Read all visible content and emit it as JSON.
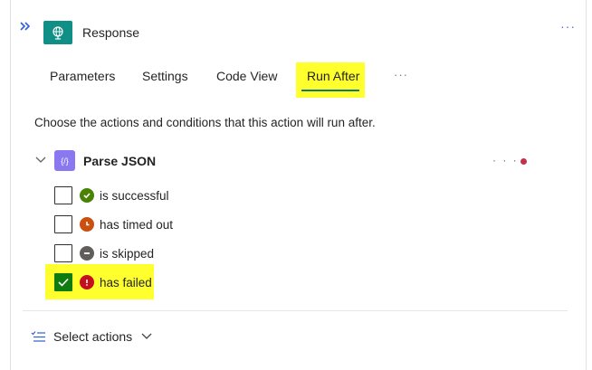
{
  "header": {
    "title": "Response",
    "more_label": "···",
    "collapse_label": "»"
  },
  "tabs": [
    {
      "label": "Parameters",
      "selected": false
    },
    {
      "label": "Settings",
      "selected": false
    },
    {
      "label": "Code View",
      "selected": false
    },
    {
      "label": "Run After",
      "selected": true
    }
  ],
  "tabs_more_label": "···",
  "description": "Choose the actions and conditions that this action will run after.",
  "action": {
    "title": "Parse JSON",
    "icon_text": "{/}",
    "more_label": "· · ·",
    "status_color": "#c4314b"
  },
  "options": [
    {
      "label": "is successful",
      "checked": false,
      "icon": "check-circle-icon",
      "color": "#498205"
    },
    {
      "label": "has timed out",
      "checked": false,
      "icon": "clock-icon",
      "color": "#ca5010"
    },
    {
      "label": "is skipped",
      "checked": false,
      "icon": "skip-icon",
      "color": "#605e5c"
    },
    {
      "label": "has failed",
      "checked": true,
      "icon": "error-icon",
      "color": "#c50f1f"
    }
  ],
  "footer": {
    "select_label": "Select actions"
  },
  "colors": {
    "highlight": "#ffff2e",
    "accent": "#0e7a7a",
    "app_icon": "#0f8f85",
    "action_icon": "#8a78f0"
  }
}
